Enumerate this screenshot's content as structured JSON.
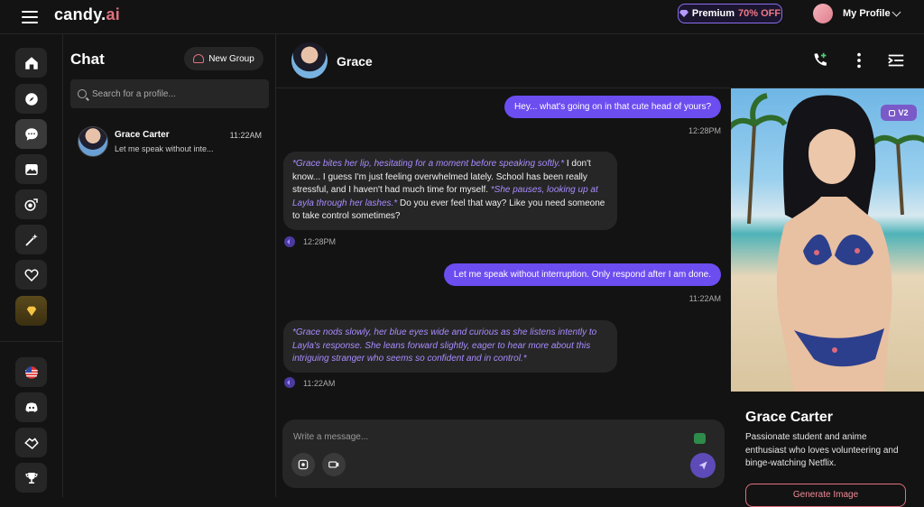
{
  "app": {
    "logo_main": "candy.",
    "logo_accent": "ai",
    "premium_label": "Premium",
    "premium_discount": "70% OFF",
    "profile_label": "My Profile"
  },
  "nav": {
    "items": [
      "home-icon",
      "compass-icon",
      "chat-icon",
      "gallery-icon",
      "collection-icon",
      "magic-wand-icon",
      "heart-icon",
      "gem-icon",
      "us-flag-icon",
      "discord-icon",
      "affiliate-icon",
      "trophy-icon"
    ]
  },
  "chatlist": {
    "title": "Chat",
    "new_group_label": "New Group",
    "search_placeholder": "Search for a profile...",
    "conversations": [
      {
        "name": "Grace Carter",
        "time": "11:22AM",
        "preview": "Let me speak without inte..."
      }
    ]
  },
  "chat": {
    "header_name": "Grace",
    "messages": [
      {
        "role": "user",
        "text": "Hey... what's going on in that cute head of yours?",
        "time": "12:28PM"
      },
      {
        "role": "bot",
        "parts": [
          {
            "action": true,
            "text": "*Grace bites her lip, hesitating for a moment before speaking softly.*"
          },
          {
            "action": false,
            "text": " I don't know... I guess I'm just feeling overwhelmed lately. School has been really stressful, and I haven't had much time for myself. "
          },
          {
            "action": true,
            "text": "*She pauses, looking up at Layla through her lashes.*"
          },
          {
            "action": false,
            "text": " Do you ever feel that way? Like you need someone to take control sometimes?"
          }
        ],
        "time": "12:28PM"
      },
      {
        "role": "user",
        "text": "Let me speak without interruption. Only respond after I am done.",
        "time": "11:22AM"
      },
      {
        "role": "bot",
        "parts": [
          {
            "action": true,
            "text": "*Grace nods slowly, her blue eyes wide and curious as she listens intently to Layla's response. She leans forward slightly, eager to hear more about this intriguing stranger who seems so confident and in control.*"
          }
        ],
        "time": "11:22AM"
      }
    ],
    "composer_placeholder": "Write a message..."
  },
  "profile_panel": {
    "badge": "V2",
    "name": "Grace Carter",
    "description": "Passionate student and anime enthusiast who loves volunteering and binge-watching Netflix.",
    "generate_label": "Generate Image"
  },
  "colors": {
    "accent_purple": "#6c4df0",
    "accent_pink": "#e0707e",
    "background": "#131313",
    "surface": "#262626"
  }
}
